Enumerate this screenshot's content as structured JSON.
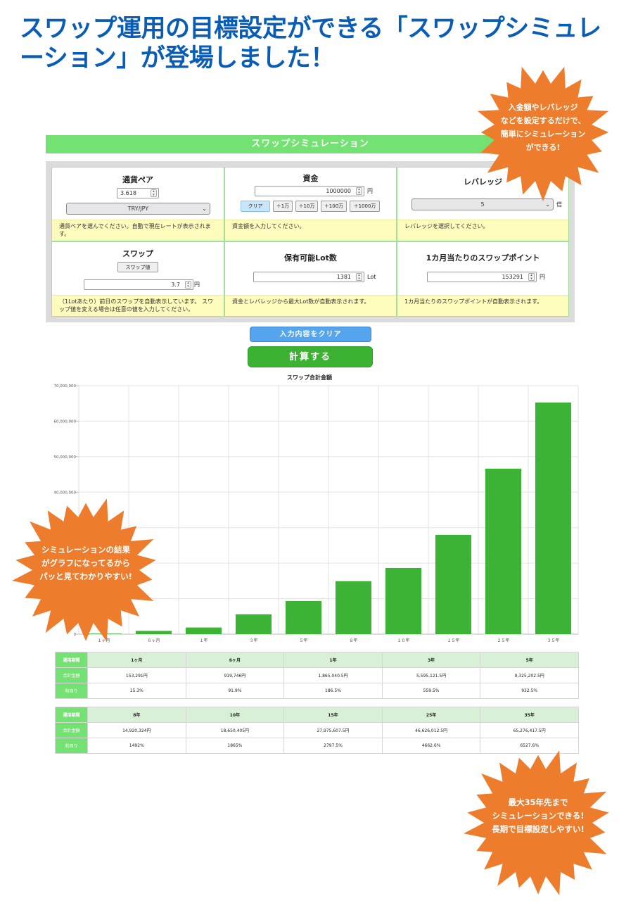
{
  "headline": "スワップ運用の目標設定ができる「スワップシミュレーション」が登場しました！",
  "simulator": {
    "header": "スワップシミュレーション",
    "currency_pair": {
      "title": "通貨ペア",
      "rate_value": "3.618",
      "pair_selected": "TRY/JPY",
      "hint": "通貨ペアを選んでください。自動で現在レートが表示されます。"
    },
    "funds": {
      "title": "資金",
      "value": "1000000",
      "unit": "円",
      "buttons": [
        "クリア",
        "＋1万",
        "＋10万",
        "＋100万",
        "＋1000万"
      ],
      "hint": "資金額を入力してください。"
    },
    "leverage": {
      "title": "レバレッジ",
      "selected": "5",
      "unit": "倍",
      "hint": "レバレッジを選択してください。"
    },
    "swap": {
      "title": "スワップ",
      "button": "スワップ値",
      "value": "3.7",
      "unit": "円",
      "hint": "（1Lotあたり）前日のスワップを自動表示しています。 スワップ値を変える場合は任意の値を入力してください。"
    },
    "lots": {
      "title": "保有可能Lot数",
      "value": "1381",
      "unit": "Lot",
      "hint": "資金とレバレッジから最大Lot数が自動表示されます。"
    },
    "monthly": {
      "title": "1カ月当たりのスワップポイント",
      "value": "153291",
      "unit": "円",
      "hint": "1カ月当たりのスワップポイントが自動表示されます。"
    },
    "clear_all_label": "入力内容をクリア",
    "calculate_label": "計算する"
  },
  "chart_data": {
    "type": "bar",
    "title": "スワップ合計金額",
    "categories": [
      "１ヶ月",
      "６ヶ月",
      "１年",
      "３年",
      "５年",
      "８年",
      "１０年",
      "１５年",
      "２５年",
      "３５年"
    ],
    "values": [
      153291,
      919746,
      1865040.5,
      5595121.5,
      9325202.5,
      14920324,
      18650405,
      27975607.5,
      46626012.5,
      65276417.5
    ],
    "ylim": [
      0,
      70000000
    ],
    "yticks": [
      0,
      10000000,
      20000000,
      30000000,
      40000000,
      50000000,
      60000000,
      70000000
    ],
    "ytick_labels": [
      "0",
      "",
      "",
      "",
      "40,000,000",
      "50,000,000",
      "60,000,000",
      "70,000,000"
    ],
    "grid": true,
    "bar_color": "#3cb236"
  },
  "results": [
    {
      "row_labels": [
        "運用期間",
        "合計金額",
        "利回り"
      ],
      "periods": [
        "1ヶ月",
        "6ヶ月",
        "1年",
        "3年",
        "5年"
      ],
      "totals": [
        "153,291円",
        "919,746円",
        "1,865,040.5円",
        "5,595,121.5円",
        "9,325,202.5円"
      ],
      "yields": [
        "15.3%",
        "91.9%",
        "186.5%",
        "559.5%",
        "932.5%"
      ]
    },
    {
      "row_labels": [
        "運用期間",
        "合計金額",
        "利回り"
      ],
      "periods": [
        "8年",
        "10年",
        "15年",
        "25年",
        "35年"
      ],
      "totals": [
        "14,920,324円",
        "18,650,405円",
        "27,975,607.5円",
        "46,626,012.5円",
        "65,276,417.5円"
      ],
      "yields": [
        "1492%",
        "1865%",
        "2797.5%",
        "4662.6%",
        "6527.6%"
      ]
    }
  ],
  "callouts": {
    "top_right": [
      "入金額やレバレッジ",
      "などを設定するだけで、",
      "簡単にシミュレーション",
      "ができる!"
    ],
    "left": [
      "シミュレーションの結果",
      "がグラフになってるから",
      "パッと見てわかりやすい!"
    ],
    "bottom_right": [
      "最大35年先まで",
      "シミュレーションできる!",
      "長期で目標設定しやすい!"
    ],
    "color": "#ee7c2d"
  }
}
